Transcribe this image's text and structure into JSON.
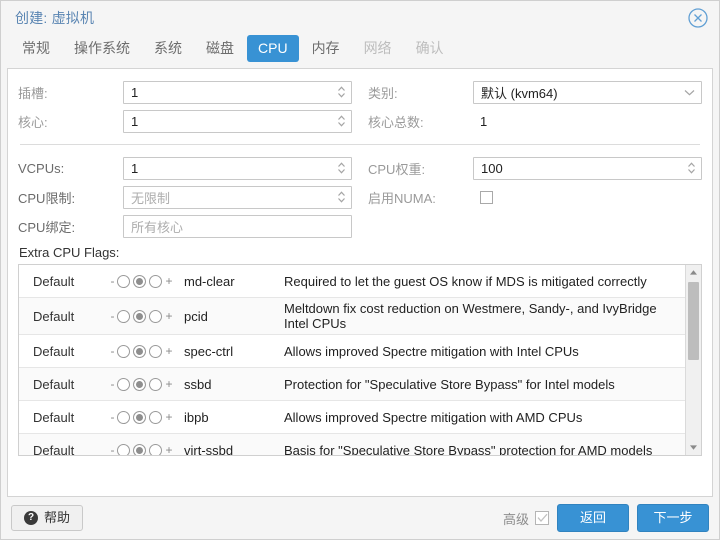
{
  "window": {
    "title": "创建: 虚拟机",
    "close_icon": "close-circle-icon"
  },
  "tabs": [
    {
      "label": "常规",
      "state": "normal"
    },
    {
      "label": "操作系统",
      "state": "normal"
    },
    {
      "label": "系统",
      "state": "normal"
    },
    {
      "label": "磁盘",
      "state": "normal"
    },
    {
      "label": "CPU",
      "state": "active"
    },
    {
      "label": "内存",
      "state": "normal"
    },
    {
      "label": "网络",
      "state": "disabled"
    },
    {
      "label": "确认",
      "state": "disabled"
    }
  ],
  "form": {
    "sockets": {
      "label": "插槽:",
      "value": "1"
    },
    "cores": {
      "label": "核心:",
      "value": "1"
    },
    "type": {
      "label": "类别:",
      "value": "默认 (kvm64)"
    },
    "total_cores": {
      "label": "核心总数:",
      "value": "1"
    },
    "vcpus": {
      "label": "VCPUs:",
      "value": "1"
    },
    "cpu_limit": {
      "label": "CPU限制:",
      "placeholder": "无限制"
    },
    "cpu_affinity": {
      "label": "CPU绑定:",
      "placeholder": "所有核心"
    },
    "cpu_units": {
      "label": "CPU权重:",
      "value": "100"
    },
    "enable_numa": {
      "label": "启用NUMA:",
      "checked": false
    }
  },
  "flags": {
    "title": "Extra CPU Flags:",
    "rows": [
      {
        "state": "Default",
        "selected": 1,
        "name": "md-clear",
        "desc": "Required to let the guest OS know if MDS is mitigated correctly"
      },
      {
        "state": "Default",
        "selected": 1,
        "name": "pcid",
        "desc": "Meltdown fix cost reduction on Westmere, Sandy-, and IvyBridge Intel CPUs"
      },
      {
        "state": "Default",
        "selected": 1,
        "name": "spec-ctrl",
        "desc": "Allows improved Spectre mitigation with Intel CPUs"
      },
      {
        "state": "Default",
        "selected": 1,
        "name": "ssbd",
        "desc": "Protection for \"Speculative Store Bypass\" for Intel models"
      },
      {
        "state": "Default",
        "selected": 1,
        "name": "ibpb",
        "desc": "Allows improved Spectre mitigation with AMD CPUs"
      },
      {
        "state": "Default",
        "selected": 1,
        "name": "virt-ssbd",
        "desc": "Basis for \"Speculative Store Bypass\" protection for AMD models"
      }
    ],
    "minus_sign": "-",
    "plus_sign": "+"
  },
  "footer": {
    "help_label": "帮助",
    "help_icon": "question-mark-icon",
    "advanced_label": "高级",
    "advanced_checked": true,
    "advanced_check_glyph": "✓",
    "back_label": "返回",
    "next_label": "下一步"
  },
  "colors": {
    "accent": "#3892d4",
    "title_text": "#5b86b3",
    "label_gray": "#9a9a9a"
  }
}
